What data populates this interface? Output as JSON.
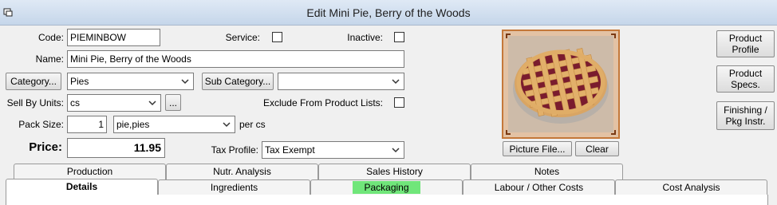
{
  "window": {
    "title": "Edit Mini Pie, Berry of the Woods"
  },
  "form": {
    "code_label": "Code:",
    "code_value": "PIEMINBOW",
    "service_label": "Service:",
    "inactive_label": "Inactive:",
    "name_label": "Name:",
    "name_value": "Mini Pie, Berry of the Woods",
    "category_button": "Category...",
    "category_value": "Pies",
    "subcategory_button": "Sub Category...",
    "subcategory_value": "",
    "sell_by_units_label": "Sell By Units:",
    "sell_by_units_value": "cs",
    "ellipsis_button": "...",
    "exclude_label": "Exclude From Product Lists:",
    "pack_size_label": "Pack Size:",
    "pack_size_value": "1",
    "pack_unit_value": "pie,pies",
    "per_label": "per cs",
    "price_label": "Price:",
    "price_value": "11.95",
    "tax_profile_label": "Tax Profile:",
    "tax_profile_value": "Tax Exempt"
  },
  "picture": {
    "picture_file_button": "Picture File...",
    "clear_button": "Clear"
  },
  "side_buttons": {
    "product_profile": [
      "Product",
      "Profile"
    ],
    "product_specs": [
      "Product",
      "Specs."
    ],
    "finishing": [
      "Finishing /",
      "Pkg Instr."
    ]
  },
  "tabs": {
    "row1": [
      "Production",
      "Nutr. Analysis",
      "Sales History",
      "Notes"
    ],
    "row2": [
      "Details",
      "Ingredients",
      "Packaging",
      "Labour / Other Costs",
      "Cost Analysis"
    ]
  },
  "colors": {
    "title_bar": "#c5d6ea",
    "picture_border": "#c4783a",
    "packaging_highlight": "#70e67a"
  }
}
